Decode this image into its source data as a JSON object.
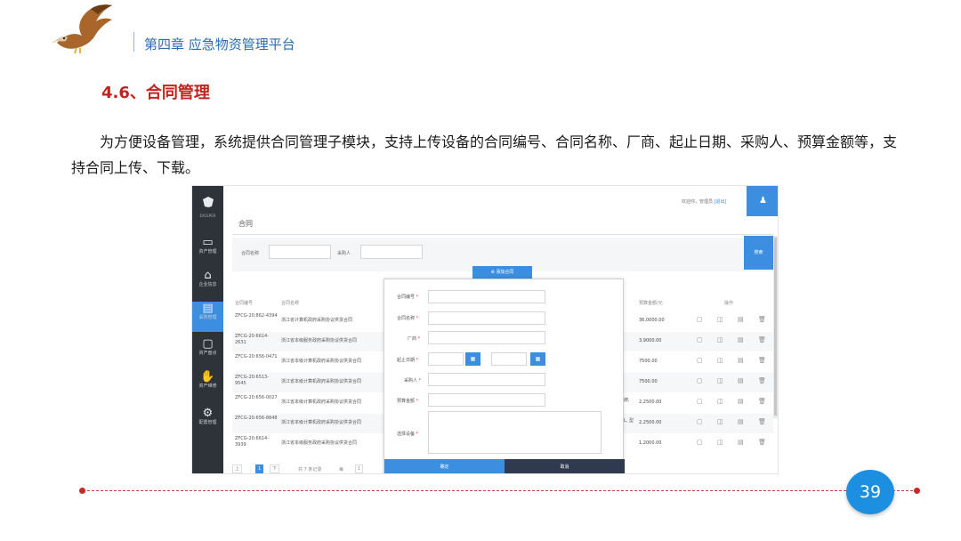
{
  "slide": {
    "chapter": "第四章  应急物资管理平台",
    "section_title": "4.6、合同管理",
    "paragraph": "为方便设备管理，系统提供合同管理子模块，支持上传设备的合同编号、合同名称、厂商、起止日期、采购人、预算金额等，支持合同上传、下载。",
    "page_number": "39"
  },
  "app": {
    "brand_text": "EXCEPER",
    "sidebar": [
      {
        "label": "资产管理",
        "icon": "folder-icon"
      },
      {
        "label": "企业信息",
        "icon": "home-icon"
      },
      {
        "label": "采购管理",
        "icon": "doc-icon",
        "active": true
      },
      {
        "label": "资产盘点",
        "icon": "monitor-icon"
      },
      {
        "label": "资产维修",
        "icon": "hand-icon"
      },
      {
        "label": "配置管理",
        "icon": "gear-icon"
      }
    ],
    "topbar": {
      "welcome": "欢迎你，管理员",
      "logout": "[退出]"
    },
    "page_title": "合同",
    "filters": {
      "contract_name_label": "合同名称",
      "buyer_label": "采购人",
      "search_label": "搜索"
    },
    "add_button": "添加合同",
    "table": {
      "headers": {
        "no": "合同编号",
        "name": "合同名称",
        "budget": "预算金额/元",
        "ops": "操作"
      },
      "rows": [
        {
          "no": "ZFCG-20:862-4394",
          "name": "浙江省计算机政府采购协议供货合同",
          "budget": "36,0000.00"
        },
        {
          "no": "ZFCG-20:6614-2631",
          "name": "浙江省本级服务政府采购协议供货合同",
          "budget": "3,9000.00"
        },
        {
          "no": "ZFCG-20:656-0471",
          "name": "浙江省本级计算机政府采购协议供货合同",
          "budget": "7500.00"
        },
        {
          "no": "ZFCG-20:6513-9545",
          "name": "浙江省本级计算机政府采购协议供货合同",
          "budget": "7500.00"
        },
        {
          "no": "ZFCG-20:656-0027",
          "name": "浙江省本级计算机政府采购协议供货合同",
          "budget": "2,2500.00",
          "extra": "牌,"
        },
        {
          "no": "ZFCG-20:656-8848",
          "name": "浙江省本级计算机政府采购协议供货合同",
          "budget": "2,2500.00",
          "extra": "L, 型"
        },
        {
          "no": "ZFCG-20:6614-3939",
          "name": "浙江省本级服务政府采购协议供货合同",
          "budget": "1,2000.00"
        }
      ]
    },
    "pager": {
      "first": "上一页",
      "current": "1",
      "next": "下一页",
      "total": "共 7 条记录",
      "per_page_label": "每页",
      "per_page": "1"
    },
    "modal": {
      "fields": {
        "contract_no": "合同编号",
        "contract_name": "合同名称",
        "vendor": "厂商",
        "date_range": "起止日期",
        "buyer": "采购人",
        "budget": "预算金额",
        "device": "选择设备"
      },
      "required_mark": "*",
      "ok": "确定",
      "cancel": "取消"
    }
  }
}
